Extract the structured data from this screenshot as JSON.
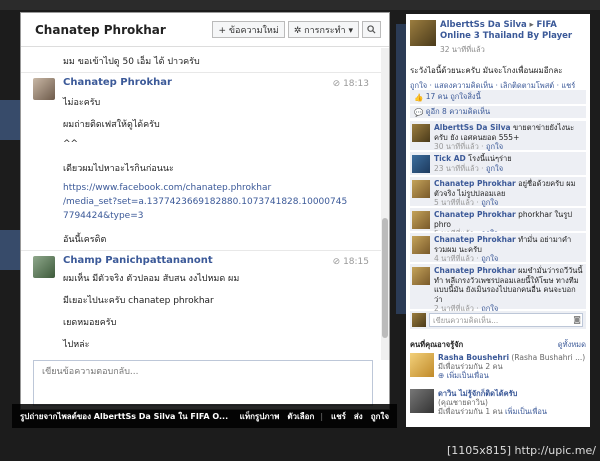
{
  "chat": {
    "title": "Chanatep Phrokhar",
    "new_message_label": "+ ข้อความใหม่",
    "actions_label": "✲ การกระทำ ▾",
    "search_icon": "search-icon",
    "first_message": "มม ขอเข้าไปดู 50 เอ็ม ได้ ปาวครับ",
    "messages": [
      {
        "sender": "Chanatep Phrokhar",
        "time": "18:13",
        "lines": [
          "ไม่อะครับ",
          "ผมถ่ายติดเฟสให้ดูได้ครับ",
          "^^",
          "เดียวผมไปหาอะไรกินก่อนนะ",
          "https://www.facebook.com/chanatep.phrokhar",
          "/media_set?set=a.1377423669182880.1073741828.10000745",
          "7794424&type=3",
          "อันนี้เครดิต"
        ]
      },
      {
        "sender": "Champ Panichpattananont",
        "time": "18:15",
        "lines": [
          "ผมเห็น มีตัวจริง ตัวปลอม สับสน งงไปหมด ผม",
          "มีเยอะไปนะครับ chanatep phrokhar",
          "เยดหมอยครับ",
          "ไปหล่ะ"
        ]
      }
    ],
    "composer_placeholder": "เขียนข้อความตอบกลับ..."
  },
  "caption_bar": {
    "title": "รูปถ่ายจากไพลต์ของ AlberttSs Da Silva ใน FIFA O...",
    "actions": [
      "แท็กรูปภาพ",
      "ตัวเลือก",
      "แชร์",
      "ส่ง",
      "ถูกใจ"
    ]
  },
  "post": {
    "author": "AlberttSs Da Silva",
    "arrow": "▸",
    "page": "FIFA Online 3 Thailand By Player",
    "time": "32 นาทีที่แล้ว",
    "description": "ระวังไอนี้ด้วยนะครับ มันจะโกงเพื่อนผมอีกละ",
    "actions": "ถูกใจ · แสดงความคิดเห็น · เลิกติดตามโพสต์ · แชร์",
    "likes": "17 คน ถูกใจสิ่งนี้",
    "view_more": "ดูอีก 8 ความคิดเห็น",
    "comments": [
      {
        "name": "AlberttSs Da Silva",
        "text": "ขายตาข่ายยังไงนะครับ ยัง เอศคนยอด 555+",
        "meta": "30 นาทีที่แล้ว · ",
        "like": "ถูกใจ"
      },
      {
        "name": "Tick AD",
        "text": "โรงนี้แน่ๆร่าย",
        "meta": "23 นาทีที่แล้ว · ",
        "like": "ถูกใจ"
      },
      {
        "name": "Chanatep Phrokhar",
        "text": "อยู่ชื่อด้วยครับ ผมตัวจริง ไม่รูปปลอมเลย",
        "meta": "5 นาทีที่แล้ว · ",
        "like": "ถูกใจ"
      },
      {
        "name": "Chanatep Phrokhar",
        "text": "phorkhar ในรูป phro",
        "meta": "5 นาทีที่แล้ว · ",
        "like": "ถูกใจ"
      },
      {
        "name": "Chanatep Phrokhar",
        "text": "ทำมั่น อย่ามาคำรวมผม นะครับ",
        "meta": "4 นาทีที่แล้ว · ",
        "like": "ถูกใจ"
      },
      {
        "name": "Chanatep Phrokhar",
        "text": "ผมขำมั่นว่ารถวีวันนี้ ทำ พลีเกรงวัวเพชรปลอมเลยนี้ให้โฆษ ทางทีมแบบนี้มัน ยังเมินรองไปบอกคนอื่น คนจะบอกว่า",
        "meta": "2 นาทีที่แล้ว · ",
        "like": "ถูกใจ"
      }
    ],
    "write_placeholder": "เขียนความคิดเห็น...",
    "camera_icon": "camera-icon"
  },
  "pymk": {
    "title": "คนที่คุณอาจรู้จัก",
    "see_all": "ดูทั้งหมด",
    "people": [
      {
        "name": "Rasha Boushehri",
        "alt": "(Rasha Bushahri ...)",
        "mutual": "มีเพื่อนร่วมกัน 2 คน",
        "add": "เพิ่มเป็นเพื่อน"
      },
      {
        "name": "ดาวิน ไม่รู้จักก็ติดได้ครับ",
        "alt": "(คุณชายดาวิน)",
        "mutual": "มีเพื่อนร่วมกัน 1 คน",
        "add": "เพิ่มเป็นเพื่อน"
      }
    ]
  },
  "watermark": "[1105x815] http://upic.me/"
}
